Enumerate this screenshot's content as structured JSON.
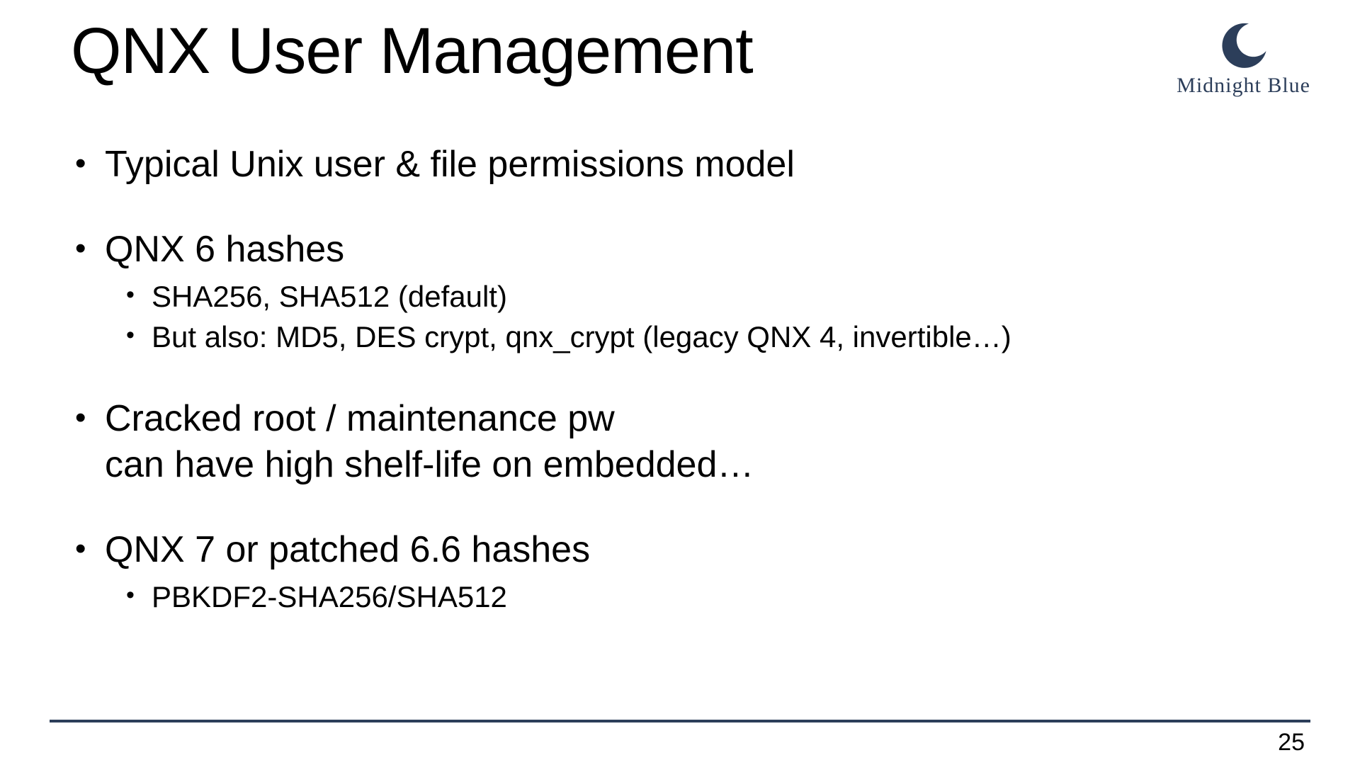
{
  "title": "QNX User Management",
  "logo": {
    "text": "Midnight Blue",
    "color": "#2c3e5a"
  },
  "bullets": [
    {
      "text": "Typical Unix user & file permissions model",
      "sub": []
    },
    {
      "text": "QNX 6 hashes",
      "sub": [
        "SHA256, SHA512 (default)",
        "But also: MD5, DES crypt, qnx_crypt (legacy QNX 4, invertible…)"
      ]
    },
    {
      "text": "Cracked root / maintenance pw\ncan have high shelf-life on embedded…",
      "sub": []
    },
    {
      "text": "QNX 7 or patched 6.6 hashes",
      "sub": [
        "PBKDF2-SHA256/SHA512"
      ]
    }
  ],
  "page_number": "25"
}
